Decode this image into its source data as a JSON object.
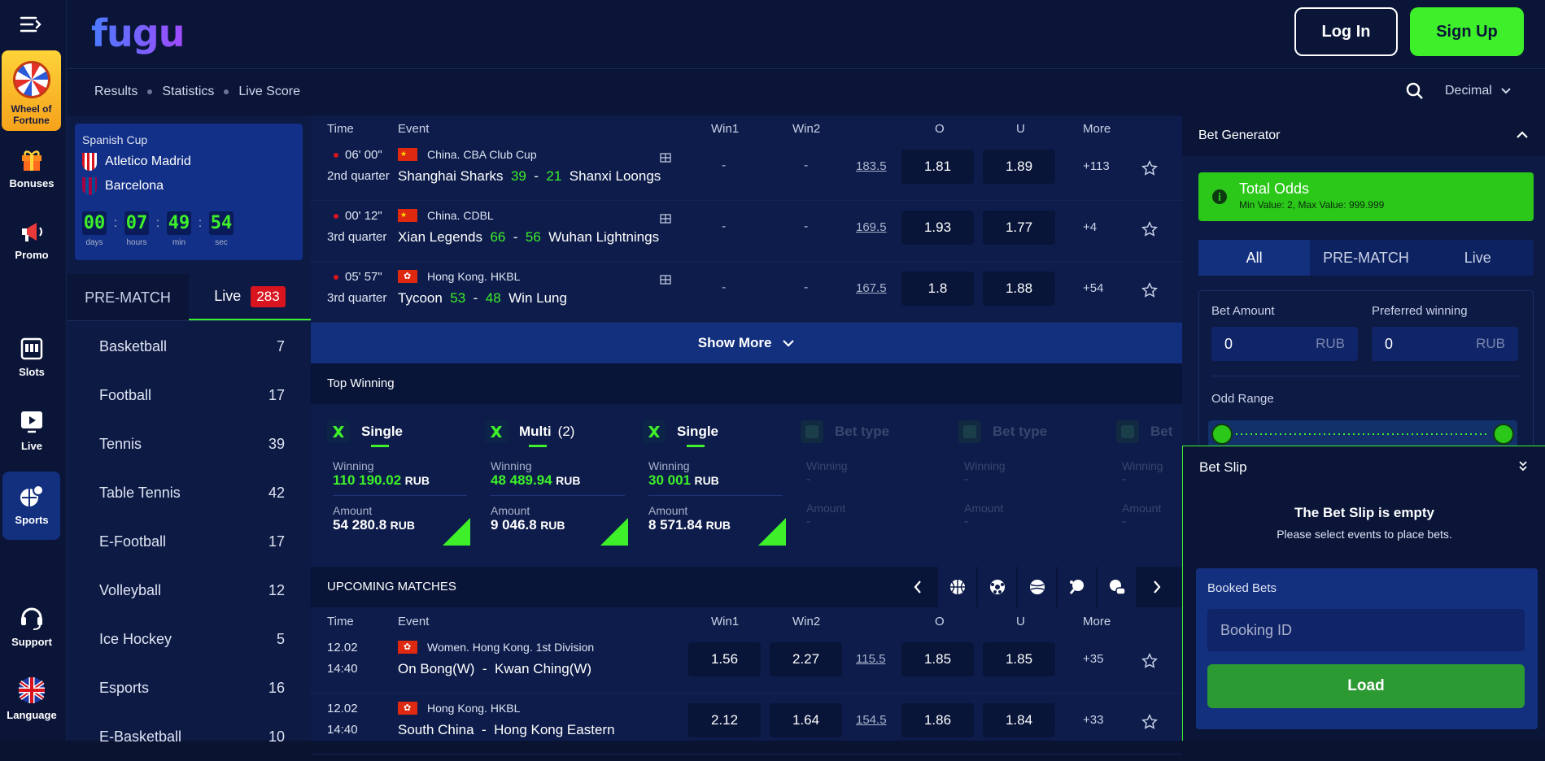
{
  "brand": {
    "logo_text": "fugu"
  },
  "header": {
    "login_label": "Log In",
    "signup_label": "Sign Up"
  },
  "subnav": {
    "links": [
      "Results",
      "Statistics",
      "Live Score"
    ],
    "odds_format": "Decimal"
  },
  "rail": {
    "wheel_label_1": "Wheel of",
    "wheel_label_2": "Fortune",
    "items": [
      {
        "label": "Bonuses"
      },
      {
        "label": "Promo"
      },
      {
        "label": "Slots"
      },
      {
        "label": "Live"
      },
      {
        "label": "Sports"
      },
      {
        "label": "Support"
      },
      {
        "label": "Language"
      }
    ]
  },
  "featured": {
    "league": "Spanish Cup",
    "team1": "Atletico Madrid",
    "team2": "Barcelona",
    "countdown": [
      {
        "value": "00",
        "unit": "days"
      },
      {
        "value": "07",
        "unit": "hours"
      },
      {
        "value": "49",
        "unit": "min"
      },
      {
        "value": "54",
        "unit": "sec"
      }
    ]
  },
  "mode_tabs": {
    "prematch": "PRE-MATCH",
    "live": "Live",
    "live_count": "283"
  },
  "sports": [
    {
      "name": "Basketball",
      "count": "7"
    },
    {
      "name": "Football",
      "count": "17"
    },
    {
      "name": "Tennis",
      "count": "39"
    },
    {
      "name": "Table Tennis",
      "count": "42"
    },
    {
      "name": "E-Football",
      "count": "17"
    },
    {
      "name": "Volleyball",
      "count": "12"
    },
    {
      "name": "Ice Hockey",
      "count": "5"
    },
    {
      "name": "Esports",
      "count": "16"
    },
    {
      "name": "E-Basketball",
      "count": "10"
    }
  ],
  "columns": {
    "time": "Time",
    "event": "Event",
    "win1": "Win1",
    "win2": "Win2",
    "o": "O",
    "u": "U",
    "more": "More"
  },
  "live_matches": [
    {
      "clock": "06' 00\"",
      "period": "2nd quarter",
      "league": "China. CBA Club Cup",
      "team1": "Shanghai Sharks",
      "score1": "39",
      "score2": "21",
      "team2": "Shanxi Loongs",
      "win1": "-",
      "win2": "-",
      "total": "183.5",
      "o": "1.81",
      "u": "1.89",
      "more": "+113"
    },
    {
      "clock": "00' 12\"",
      "period": "3rd quarter",
      "league": "China. CDBL",
      "team1": "Xian Legends",
      "score1": "66",
      "score2": "56",
      "team2": "Wuhan Lightnings",
      "win1": "-",
      "win2": "-",
      "total": "169.5",
      "o": "1.93",
      "u": "1.77",
      "more": "+4"
    },
    {
      "clock": "05' 57\"",
      "period": "3rd quarter",
      "league": "Hong Kong. HKBL",
      "team1": "Tycoon",
      "score1": "53",
      "score2": "48",
      "team2": "Win Lung",
      "win1": "-",
      "win2": "-",
      "total": "167.5",
      "o": "1.8",
      "u": "1.88",
      "more": "+54"
    }
  ],
  "show_more": "Show More",
  "top_winning": {
    "title": "Top Winning",
    "cards": [
      {
        "type": "Single",
        "count": "",
        "winning_label": "Winning",
        "winning": "110 190.02",
        "amount_label": "Amount",
        "amount": "54 280.8",
        "currency": "RUB"
      },
      {
        "type": "Multi",
        "count": "(2)",
        "winning_label": "Winning",
        "winning": "48 489.94",
        "amount_label": "Amount",
        "amount": "9 046.8",
        "currency": "RUB"
      },
      {
        "type": "Single",
        "count": "",
        "winning_label": "Winning",
        "winning": "30 001",
        "amount_label": "Amount",
        "amount": "8 571.84",
        "currency": "RUB"
      }
    ],
    "placeholders": [
      {
        "type": "Bet type",
        "winning_label": "Winning",
        "amount_label": "Amount",
        "dash": "-"
      },
      {
        "type": "Bet type",
        "winning_label": "Winning",
        "amount_label": "Amount",
        "dash": "-"
      },
      {
        "type": "Bet",
        "winning_label": "Winning",
        "amount_label": "Amount",
        "dash": "-"
      }
    ]
  },
  "upcoming": {
    "title": "UPCOMING MATCHES",
    "matches": [
      {
        "date": "12.02",
        "time": "14:40",
        "league": "Women. Hong Kong. 1st Division",
        "team1": "On Bong(W)",
        "team2": "Kwan Ching(W)",
        "win1": "1.56",
        "win2": "2.27",
        "total": "115.5",
        "o": "1.85",
        "u": "1.85",
        "more": "+35"
      },
      {
        "date": "12.02",
        "time": "14:40",
        "league": "Hong Kong. HKBL",
        "team1": "South China",
        "team2": "Hong Kong Eastern",
        "win1": "2.12",
        "win2": "1.64",
        "total": "154.5",
        "o": "1.86",
        "u": "1.84",
        "more": "+33"
      }
    ]
  },
  "bet_generator": {
    "title": "Bet Generator",
    "total_odds": "Total Odds",
    "total_hint": "Min Value: 2, Max Value: 999.999",
    "tabs": [
      "All",
      "PRE-MATCH",
      "Live"
    ],
    "bet_amount_label": "Bet Amount",
    "preferred_label": "Preferred winning",
    "bet_amount": "0",
    "preferred": "0",
    "currency": "RUB",
    "odd_range": "Odd Range"
  },
  "bet_slip": {
    "title": "Bet Slip",
    "empty_title": "The Bet Slip is empty",
    "empty_hint": "Please select events to place bets.",
    "booked_label": "Booked Bets",
    "booking_placeholder": "Booking ID",
    "load_label": "Load"
  },
  "colors": {
    "accent": "#3ef02a",
    "live_badge": "#d8141f",
    "panel": "#0d1c4a"
  }
}
